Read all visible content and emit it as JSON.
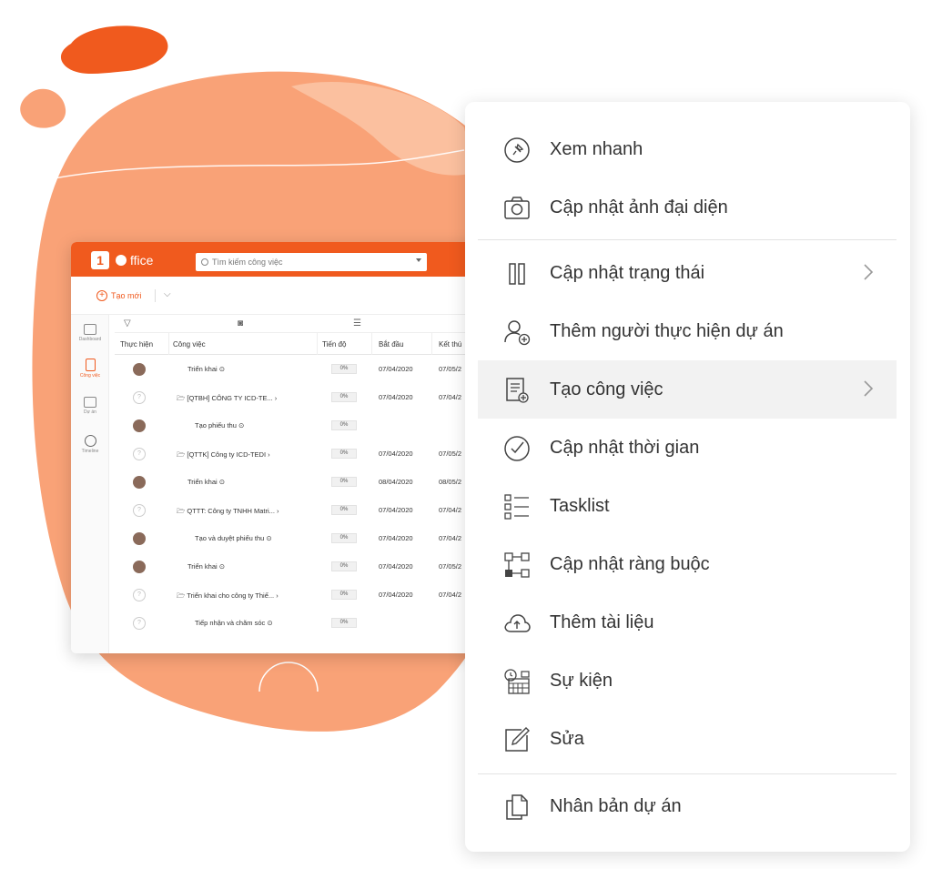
{
  "app": {
    "logo_text": "ffice",
    "search_placeholder": "Tìm kiếm công việc",
    "new_label": "Tạo mới",
    "sidebar": [
      {
        "label": "Dashboard"
      },
      {
        "label": "Công việc"
      },
      {
        "label": "Dự án"
      },
      {
        "label": "Timeline"
      }
    ],
    "table": {
      "headers": [
        "Thực hiện",
        "Công việc",
        "Tiến độ",
        "Bắt đầu",
        "Kết thú"
      ],
      "rows": [
        {
          "avatar": "photo",
          "task": "Triển khai ⊙",
          "progress": "0%",
          "start": "07/04/2020",
          "end": "07/05/2"
        },
        {
          "avatar": "unknown",
          "task": "🗁 [QTBH] CÔNG TY ICD-TE... ›",
          "progress": "0%",
          "start": "07/04/2020",
          "end": "07/04/2"
        },
        {
          "avatar": "photo",
          "task": "Tạo phiếu thu ⊙",
          "progress": "0%",
          "start": "",
          "end": ""
        },
        {
          "avatar": "unknown",
          "task": "🗁 [QTTK] Công ty ICD-TEDI ›",
          "progress": "0%",
          "start": "07/04/2020",
          "end": "07/05/2"
        },
        {
          "avatar": "photo",
          "task": "Triển khai ⊙",
          "progress": "0%",
          "start": "08/04/2020",
          "end": "08/05/2"
        },
        {
          "avatar": "unknown",
          "task": "🗁 QTTT: Công ty TNHH Matri... ›",
          "progress": "0%",
          "start": "07/04/2020",
          "end": "07/04/2"
        },
        {
          "avatar": "photo",
          "task": "Tạo và duyệt phiếu thu ⊙",
          "progress": "0%",
          "start": "07/04/2020",
          "end": "07/04/2"
        },
        {
          "avatar": "photo",
          "task": "Triển khai ⊙",
          "progress": "0%",
          "start": "07/04/2020",
          "end": "07/05/2"
        },
        {
          "avatar": "unknown",
          "task": "🗁 Triển khai cho công ty Thiế... ›",
          "progress": "0%",
          "start": "07/04/2020",
          "end": "07/04/2"
        },
        {
          "avatar": "unknown",
          "task": "Tiếp nhận và chăm sóc ⊙",
          "progress": "0%",
          "start": "",
          "end": ""
        }
      ]
    }
  },
  "menu": {
    "items": [
      {
        "label": "Xem nhanh",
        "icon": "pin-icon",
        "has_submenu": false
      },
      {
        "label": "Cập nhật ảnh đại diện",
        "icon": "camera-icon",
        "has_submenu": false
      },
      {
        "label": "Cập nhật trạng thái",
        "icon": "status-columns-icon",
        "has_submenu": true
      },
      {
        "label": "Thêm người thực hiện dự án",
        "icon": "add-user-icon",
        "has_submenu": false
      },
      {
        "label": "Tạo công việc",
        "icon": "new-task-icon",
        "has_submenu": true,
        "highlighted": true
      },
      {
        "label": "Cập nhật thời gian",
        "icon": "clock-check-icon",
        "has_submenu": false
      },
      {
        "label": "Tasklist",
        "icon": "checklist-icon",
        "has_submenu": false
      },
      {
        "label": "Cập nhật ràng buộc",
        "icon": "dependency-icon",
        "has_submenu": false
      },
      {
        "label": "Thêm tài liệu",
        "icon": "cloud-upload-icon",
        "has_submenu": false
      },
      {
        "label": "Sự kiện",
        "icon": "calendar-event-icon",
        "has_submenu": false
      },
      {
        "label": "Sửa",
        "icon": "edit-icon",
        "has_submenu": false
      },
      {
        "label": "Nhân bản dự án",
        "icon": "duplicate-icon",
        "has_submenu": false
      }
    ]
  },
  "colors": {
    "brand": "#f05a1e",
    "blob": "#f9a277",
    "blob_dark": "#f0622a"
  }
}
